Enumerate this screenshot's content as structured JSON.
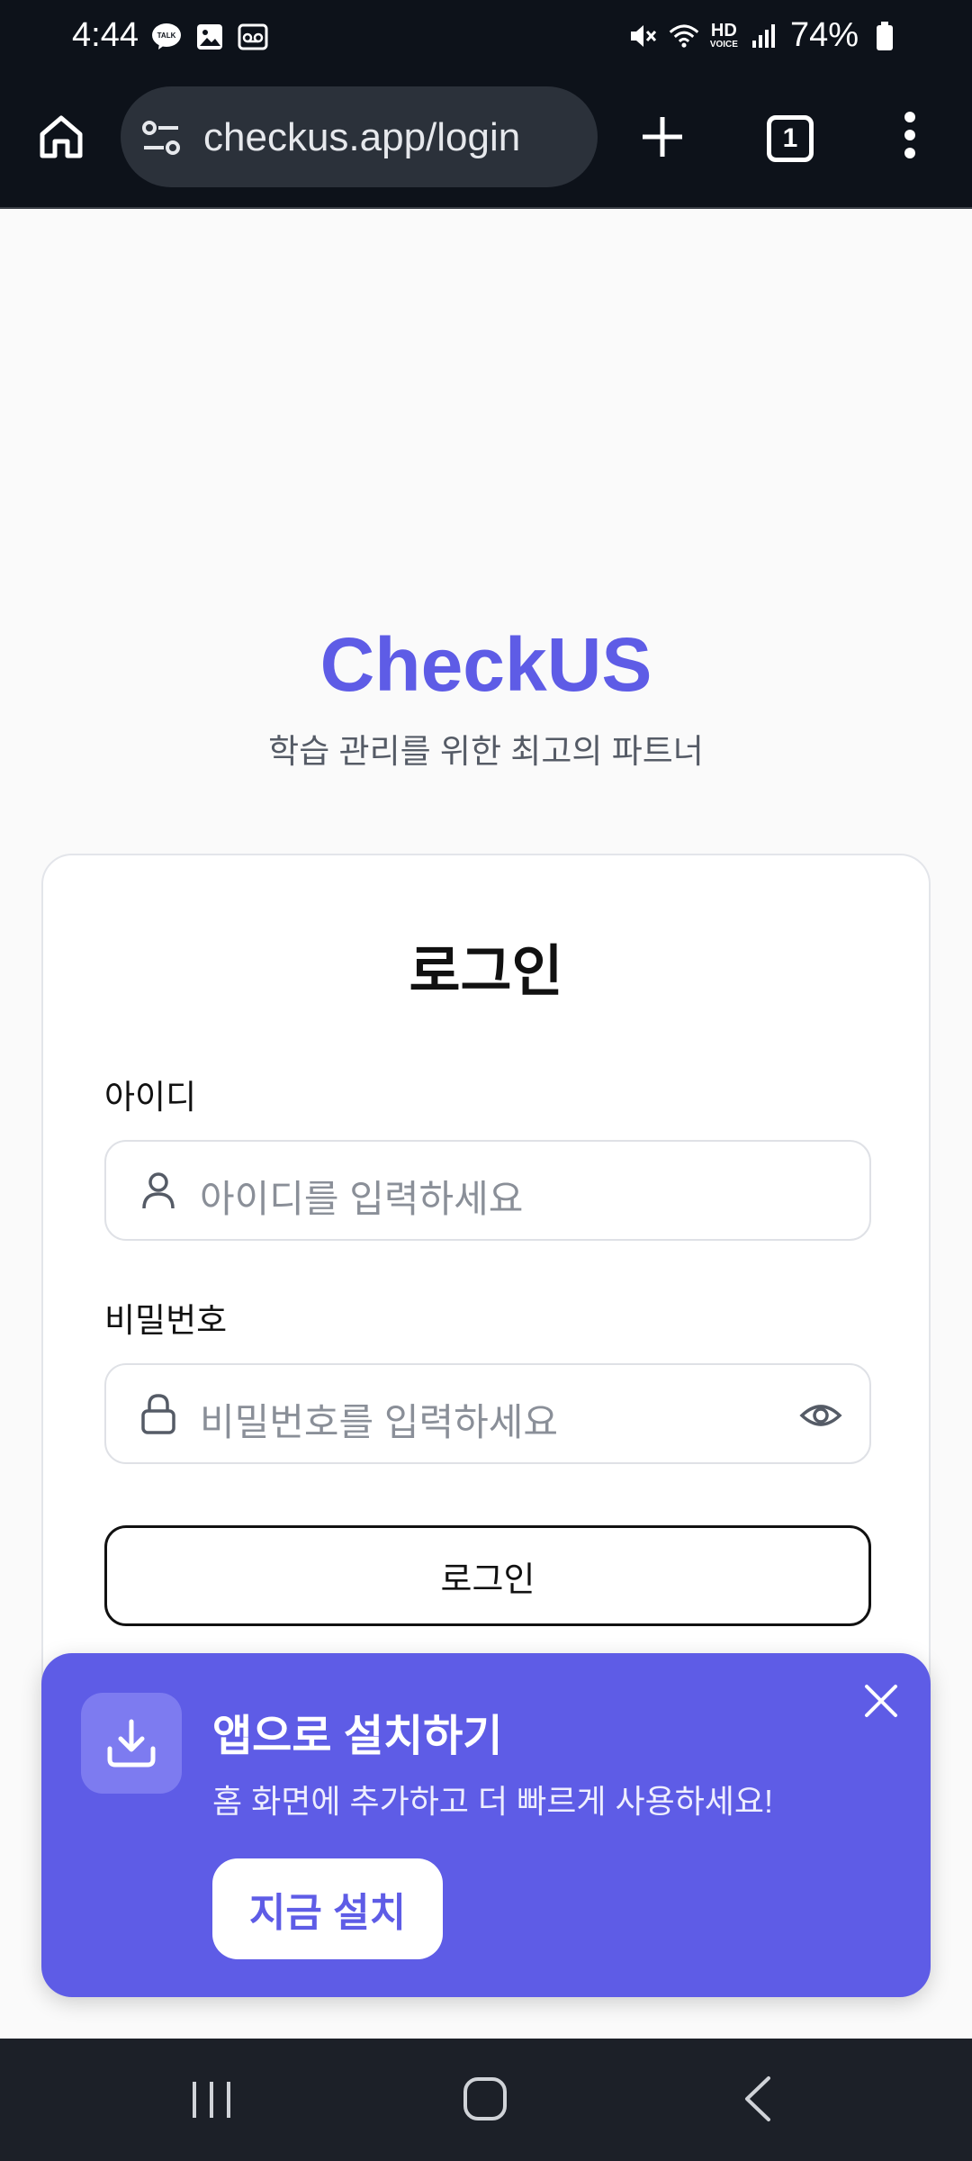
{
  "status_bar": {
    "time": "4:44",
    "battery": "74%",
    "hd_voice_top": "HD",
    "hd_voice_bottom": "VOICE",
    "left_icons": [
      "kakaotalk-talk-icon",
      "gallery-icon",
      "voicemail-icon"
    ],
    "right_icons": [
      "mute-icon",
      "wifi-icon",
      "hd-voice-icon",
      "signal-icon",
      "battery-icon"
    ]
  },
  "browser": {
    "url": "checkus.app/login",
    "tab_count": "1"
  },
  "page": {
    "brand": "CheckUS",
    "tagline": "학습 관리를 위한 최고의 파트너",
    "login_card": {
      "title": "로그인",
      "id_label": "아이디",
      "id_placeholder": "아이디를 입력하세요",
      "password_label": "비밀번호",
      "password_placeholder": "비밀번호를 입력하세요",
      "submit_label": "로그인"
    }
  },
  "install_banner": {
    "title": "앱으로 설치하기",
    "description": "홈 화면에 추가하고 더 빠르게 사용하세요!",
    "button_label": "지금 설치"
  },
  "colors": {
    "brand": "#5e5ce6",
    "status_bar_bg": "#0d121a",
    "nav_bar_bg": "#1c2028"
  }
}
